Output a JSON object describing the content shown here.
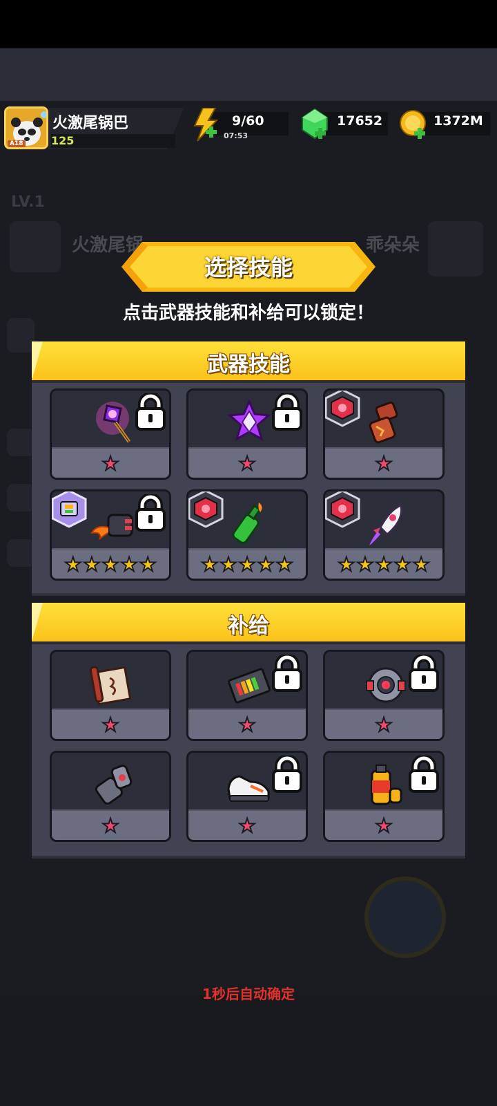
{
  "header": {
    "player_name": "火激尾锅巴",
    "player_level": "125",
    "avatar_badge": "A18",
    "energy_value": "9/60",
    "energy_timer": "07:53",
    "gems_value": "17652",
    "coins_value": "1372M"
  },
  "background": {
    "level_text": "LV.1",
    "left_name": "火激尾锅",
    "right_name": "乖朵朵"
  },
  "banner": {
    "title": "选择技能"
  },
  "subtitle": "点击武器技能和补给可以锁定！",
  "weapon_panel": {
    "title": "武器技能",
    "cards": [
      {
        "icon": "magic-staff-icon",
        "stars": 1,
        "locked": true,
        "tag": ""
      },
      {
        "icon": "purple-star-emblem-icon",
        "stars": 1,
        "locked": true,
        "tag": ""
      },
      {
        "icon": "lava-fist-icon",
        "stars": 1,
        "locked": false,
        "tag": "red-gear-tag"
      },
      {
        "icon": "flame-drone-icon",
        "stars": 5,
        "locked": true,
        "tag": "purple-chip-tag"
      },
      {
        "icon": "molotov-bottle-icon",
        "stars": 5,
        "locked": false,
        "tag": "red-gear-tag"
      },
      {
        "icon": "rocket-icon",
        "stars": 5,
        "locked": false,
        "tag": "red-gear-tag"
      }
    ]
  },
  "supply_panel": {
    "title": "补给",
    "cards": [
      {
        "icon": "scroll-icon",
        "stars": 1,
        "locked": false
      },
      {
        "icon": "battery-pack-icon",
        "stars": 1,
        "locked": true
      },
      {
        "icon": "orb-core-icon",
        "stars": 1,
        "locked": true
      },
      {
        "icon": "armor-gauntlet-icon",
        "stars": 1,
        "locked": false
      },
      {
        "icon": "sneaker-icon",
        "stars": 1,
        "locked": true
      },
      {
        "icon": "fuel-canister-icon",
        "stars": 1,
        "locked": true
      }
    ]
  },
  "countdown": "1秒后自动确定",
  "colors": {
    "star": "#f04a6e",
    "gold_star": "#f6c51c",
    "panel_header": "#fcc61d",
    "countdown": "#e0312b"
  }
}
